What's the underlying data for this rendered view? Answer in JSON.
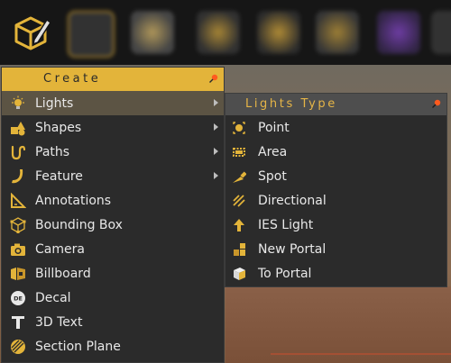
{
  "toolbar": {
    "tools": [
      {
        "icon": "create-object-icon"
      },
      {
        "icon": "bounding-tool-icon"
      },
      {
        "icon": "materials-tool-icon"
      },
      {
        "icon": "media-tool-icon"
      },
      {
        "icon": "environment-tool-icon"
      },
      {
        "icon": "settings-tool-icon"
      },
      {
        "icon": "character-tool-icon"
      },
      {
        "icon": "extra-tool-icon"
      }
    ]
  },
  "create_menu": {
    "title": "Create",
    "items": [
      {
        "label": "Lights",
        "icon": "light-bulb-icon",
        "has_submenu": true,
        "active": true
      },
      {
        "label": "Shapes",
        "icon": "shapes-icon",
        "has_submenu": true
      },
      {
        "label": "Paths",
        "icon": "paths-icon",
        "has_submenu": true
      },
      {
        "label": "Feature",
        "icon": "feature-icon",
        "has_submenu": true
      },
      {
        "label": "Annotations",
        "icon": "annotations-icon",
        "has_submenu": false
      },
      {
        "label": "Bounding Box",
        "icon": "bounding-box-icon",
        "has_submenu": false
      },
      {
        "label": "Camera",
        "icon": "camera-icon",
        "has_submenu": false
      },
      {
        "label": "Billboard",
        "icon": "billboard-icon",
        "has_submenu": false
      },
      {
        "label": "Decal",
        "icon": "decal-icon",
        "has_submenu": false
      },
      {
        "label": "3D Text",
        "icon": "text-3d-icon",
        "has_submenu": false
      },
      {
        "label": "Section Plane",
        "icon": "section-plane-icon",
        "has_submenu": false
      }
    ]
  },
  "lights_submenu": {
    "title": "Lights Type",
    "items": [
      {
        "label": "Point",
        "icon": "point-light-icon"
      },
      {
        "label": "Area",
        "icon": "area-light-icon"
      },
      {
        "label": "Spot",
        "icon": "spot-light-icon"
      },
      {
        "label": "Directional",
        "icon": "directional-light-icon"
      },
      {
        "label": "IES Light",
        "icon": "ies-light-icon"
      },
      {
        "label": "New Portal",
        "icon": "new-portal-icon"
      },
      {
        "label": "To Portal",
        "icon": "to-portal-icon"
      }
    ]
  },
  "colors": {
    "accent": "#e3b43a",
    "menu_bg": "#2b2b2b",
    "active_row": "#5c5444",
    "pin": "#ff5a1e"
  }
}
